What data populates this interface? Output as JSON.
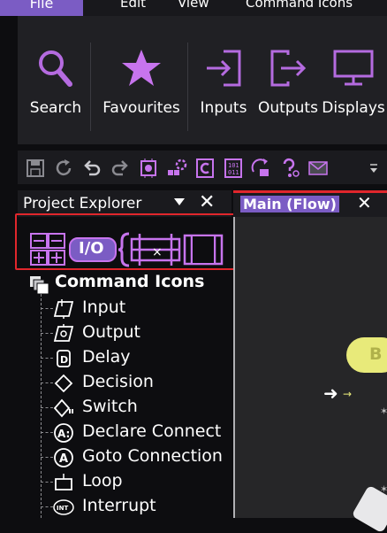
{
  "menu": {
    "file": "File",
    "edit": "Edit",
    "view": "View",
    "command_icons": "Command Icons"
  },
  "ribbon": {
    "search": "Search",
    "favourites": "Favourites",
    "inputs": "Inputs",
    "outputs": "Outputs",
    "displays": "Displays"
  },
  "accent_color": "#7b5cc4",
  "highlight_color": "#e0262c",
  "project_explorer": {
    "title": "Project Explorer",
    "palette_label": "I/O",
    "root": "Command Icons",
    "items": [
      {
        "label": "Input",
        "icon": "input-icon"
      },
      {
        "label": "Output",
        "icon": "output-icon"
      },
      {
        "label": "Delay",
        "icon": "delay-icon"
      },
      {
        "label": "Decision",
        "icon": "decision-icon"
      },
      {
        "label": "Switch",
        "icon": "switch-icon"
      },
      {
        "label": "Declare Connect",
        "icon": "declare-connection-icon"
      },
      {
        "label": "Goto Connection",
        "icon": "goto-connection-icon"
      },
      {
        "label": "Loop",
        "icon": "loop-icon"
      },
      {
        "label": "Interrupt",
        "icon": "interrupt-icon"
      }
    ]
  },
  "flow_tab": {
    "label": "Main (Flow)",
    "close": "✕"
  },
  "canvas": {
    "node_text": "B"
  }
}
